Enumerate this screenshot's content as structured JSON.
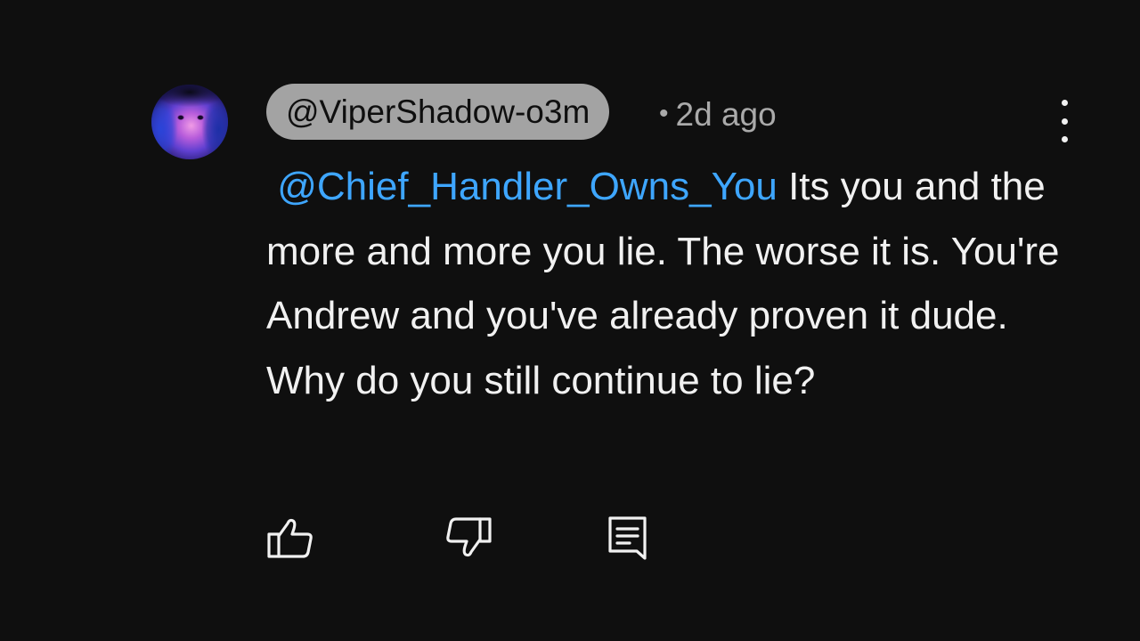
{
  "comment": {
    "author": "@ViperShadow-o3m",
    "separator": "•",
    "timestamp": "2d ago",
    "mention": "@Chief_Handler_Owns_You",
    "text_line1_rest": "Its you and",
    "text_rest": "the more and more you lie. The worse it is. You're Andrew and you've already proven it dude. Why do you still continue to lie?"
  },
  "icons": {
    "avatar": "avatar",
    "more": "more-vertical-icon",
    "like": "thumbs-up-icon",
    "dislike": "thumbs-down-icon",
    "reply": "reply-comment-icon"
  },
  "colors": {
    "background": "#0f0f0f",
    "text": "#f1f1f1",
    "mention": "#3ea6ff",
    "author_chip": "#a3a3a3",
    "meta": "#aaaaaa"
  }
}
